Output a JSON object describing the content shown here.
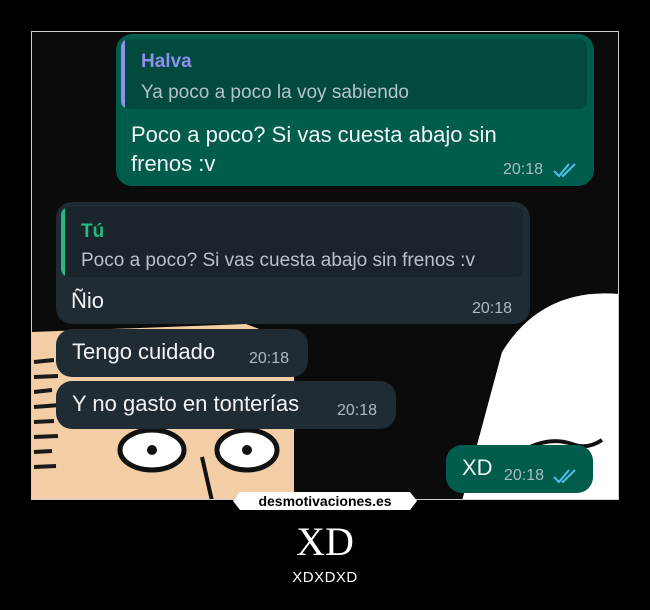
{
  "chat": {
    "msg1": {
      "quote_name": "Halva",
      "quote_text": "Ya poco a poco la voy sabiendo",
      "text_line1": "Poco a poco? Si vas cuesta abajo sin",
      "text_line2": "frenos :v",
      "time": "20:18"
    },
    "msg2": {
      "quote_name": "Tú",
      "quote_text": "Poco a poco? Si vas cuesta abajo sin frenos :v",
      "text": "Ñio",
      "time": "20:18"
    },
    "msg3": {
      "text": "Tengo cuidado",
      "time": "20:18"
    },
    "msg4": {
      "text": "Y no gasto en tonterías",
      "time": "20:18"
    },
    "msg5": {
      "text": "XD",
      "time": "20:18"
    }
  },
  "poster": {
    "watermark": "desmotivaciones.es",
    "title": "XD",
    "subtitle": "XDXDXD"
  },
  "colors": {
    "outgoing_bubble": "#005c4b",
    "incoming_bubble": "#202c33",
    "quote_name_halva": "#8f8ff0",
    "quote_name_tu": "#25b982",
    "read_ticks": "#53bdeb"
  },
  "icons": [
    "double-check-icon"
  ]
}
